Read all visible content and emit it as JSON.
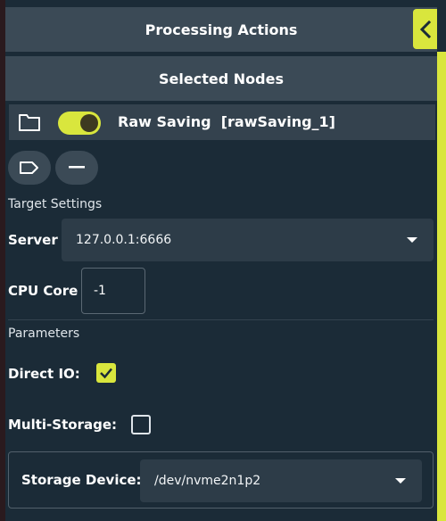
{
  "header": {
    "title": "Processing Actions"
  },
  "subheader": {
    "title": "Selected Nodes"
  },
  "node": {
    "name": "Raw Saving  [rawSaving_1]",
    "enabled": true
  },
  "target_settings": {
    "label": "Target Settings",
    "server_label": "Server",
    "server_value": "127.0.0.1:6666",
    "cpu_label": "CPU Core",
    "cpu_value": "-1"
  },
  "parameters": {
    "label": "Parameters",
    "direct_io_label": "Direct IO:",
    "direct_io_checked": true,
    "multi_storage_label": "Multi-Storage:",
    "multi_storage_checked": false,
    "storage_device_label": "Storage Device:",
    "storage_device_value": "/dev/nvme2n1p2"
  },
  "colors": {
    "accent": "#d9e63d",
    "background": "#1b2b37",
    "header_bg": "#3b4a56",
    "field_bg": "#2d3c48"
  },
  "icons": [
    "chevron-left-icon",
    "folder-icon",
    "tag-icon",
    "minus-icon",
    "dropdown-caret-icon",
    "checkmark-icon"
  ]
}
